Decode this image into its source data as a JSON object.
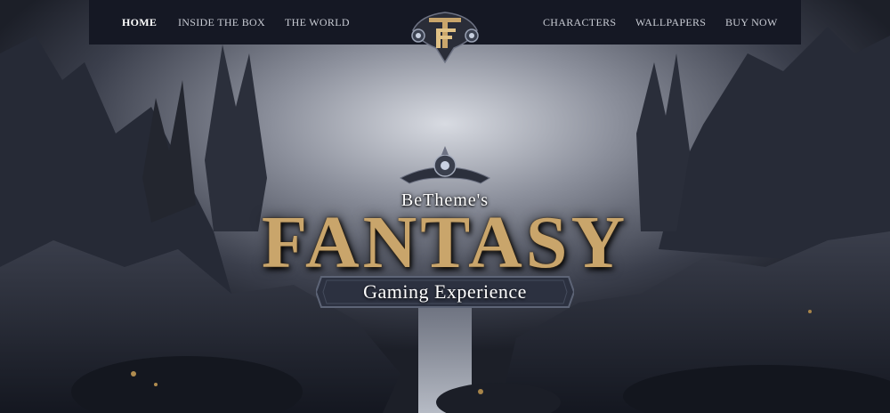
{
  "nav": {
    "left": [
      {
        "label": "HOME",
        "active": true
      },
      {
        "label": "INSIDE THE BOX",
        "active": false
      },
      {
        "label": "THE WORLD",
        "active": false
      }
    ],
    "right": [
      {
        "label": "CHARACTERS",
        "active": false
      },
      {
        "label": "WALLPAPERS",
        "active": false
      },
      {
        "label": "BUY NOW",
        "active": false
      }
    ]
  },
  "logo": {
    "icon": "ornate-tf-monogram-logo"
  },
  "hero": {
    "overline": "BeTheme's",
    "title": "FANTASY",
    "tagline": "Gaming Experience"
  },
  "colors": {
    "nav_bg": "#151824",
    "title_gold": "#c9a56b",
    "sky": "#8a8e9a",
    "rock_dark": "#1e212b"
  }
}
